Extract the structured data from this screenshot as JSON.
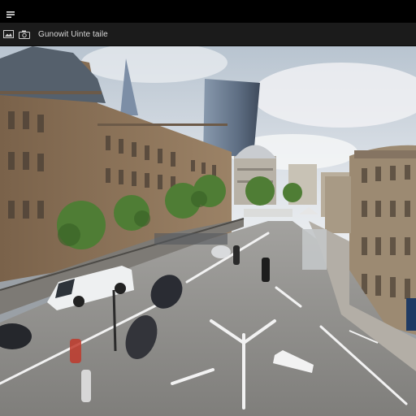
{
  "window": {
    "menu_icon": "window-menu-icon"
  },
  "toolbar": {
    "icons": [
      "image-icon",
      "camera-icon"
    ],
    "title": "Gunowit Uinte taile"
  },
  "viewer": {
    "content_icon": "street-photo",
    "colors": {
      "sky": "#cfd6de",
      "road": "#8f8f8f",
      "building_left": "#8c7358",
      "tower_glass": "#6f7f95",
      "trees": "#4e7a36"
    }
  }
}
